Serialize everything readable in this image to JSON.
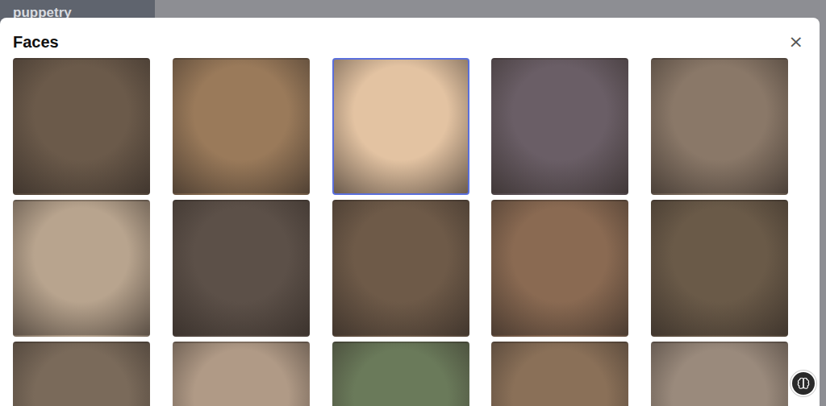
{
  "app": {
    "logo": "puppetry"
  },
  "modal": {
    "title": "Faces",
    "close": "×"
  },
  "faces": [
    {
      "selected": false,
      "color": "#6b5a4a"
    },
    {
      "selected": false,
      "color": "#9a7a5a"
    },
    {
      "selected": true,
      "color": "#e3c3a2"
    },
    {
      "selected": false,
      "color": "#6a5e66"
    },
    {
      "selected": false,
      "color": "#8a7868"
    },
    {
      "selected": false,
      "color": "#b8a48e"
    },
    {
      "selected": false,
      "color": "#5c5048"
    },
    {
      "selected": false,
      "color": "#6e5a48"
    },
    {
      "selected": false,
      "color": "#8a6a52"
    },
    {
      "selected": false,
      "color": "#6a5a48"
    },
    {
      "selected": false,
      "color": "#7a6a5a"
    },
    {
      "selected": false,
      "color": "#b09a86"
    },
    {
      "selected": false,
      "color": "#6a7a5a"
    },
    {
      "selected": false,
      "color": "#8a7058"
    },
    {
      "selected": false,
      "color": "#9a8a7c"
    }
  ]
}
